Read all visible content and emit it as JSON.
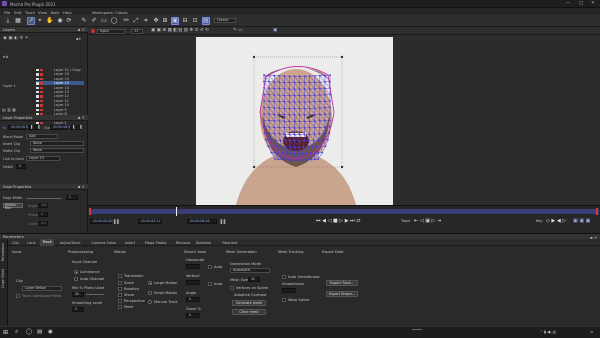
{
  "window": {
    "title": "Mocha Pro Plugin 2021"
  },
  "menu": [
    "File",
    "Edit",
    "Track",
    "View",
    "Tools",
    "Help",
    "Workspace: Classic"
  ],
  "toolbar": {
    "workspace": "Classic",
    "layer_select": "Input",
    "frame": "11"
  },
  "layers": {
    "title": "Layers",
    "items": [
      "Layer 21 / Copy",
      "Layer 20",
      "Layer 19",
      "Layer 15",
      "Layer 14",
      "Layer 13",
      "Layer 12",
      "Layer 11",
      "Layer 10",
      "Layer 9",
      "Layer 8",
      "Layer 7",
      "Layer 1"
    ],
    "selected_index": 3,
    "footer_label": "Layer 1"
  },
  "layer_props": {
    "title": "Layer Properties",
    "in_label": "In",
    "in_value": "00:00:00:00",
    "out_label": "Out",
    "out_value": "00:00:06:16",
    "blend_mode_label": "Blend Mode",
    "blend_mode": "Add",
    "insert_clip_label": "Insert Clip",
    "insert_clip": "None",
    "matte_clip_label": "Matte Clip",
    "matte_clip": "None",
    "link_track_label": "Link to track",
    "link_track": "Layer 23",
    "feather_label": "Detail",
    "feather": "0"
  },
  "edge_props": {
    "title": "Edge Properties",
    "edge_width_label": "Edge Width",
    "edge_width": "1",
    "motion_blur_label": "Motion Blur",
    "angle_label": "Angle",
    "angle": "180",
    "phase_label": "Phase",
    "phase": "0",
    "quality_label": "Quality",
    "quality": "0.0"
  },
  "timeline": {
    "start": "00:00:00:00",
    "end": "00:00:06:16",
    "current": "00:00:00:11",
    "track_label": "Track",
    "key_label": "Key"
  },
  "params": {
    "title": "Parameters",
    "tabs": [
      "Clip",
      "Lens",
      "Track",
      "AdjustTrack",
      "Camera Solve",
      "Insert",
      "Mega Plates",
      "Remove",
      "Stabilize",
      "Reorient"
    ],
    "selected_tab": "Track"
  },
  "side_tabs": [
    "Parameters",
    "Dope Sheet"
  ],
  "input": {
    "title": "Input",
    "clip_label": "Clip",
    "clip": "Layer Below",
    "track_individual": "Track Individual Fields"
  },
  "preprocessing": {
    "title": "Preprocessing",
    "input_channel": "Input Channel",
    "luminance": "Luminance",
    "auto_channel": "Auto Channel",
    "min_pixels": "Min % Pixels Used",
    "min_pixels_value": "90",
    "smoothing": "Smoothing Level",
    "smoothing_value": "0"
  },
  "motion": {
    "title": "Motion",
    "translation": "Translation",
    "scale": "Scale",
    "rotation": "Rotation",
    "shear": "Shear",
    "perspective": "Perspective",
    "mesh": "Mesh",
    "large_motion": "Large Motion",
    "small_motion": "Small Motion",
    "manual_track": "Manual Track"
  },
  "search_area": {
    "title": "Search Area",
    "horizontal": "Horizontal",
    "vertical": "Vertical",
    "angle": "Angle",
    "angle_value": "0",
    "zoom": "Zoom %",
    "zoom_value": "0",
    "auto": "Auto"
  },
  "mesh_generation": {
    "title": "Mesh Generation",
    "mode_label": "Generation Mode",
    "mode": "Automatic",
    "mesh_size": "Mesh Size",
    "mesh_size_value": "50",
    "vertices_on_spline": "Vertices on Spline",
    "adaptive_contrast": "Adaptive Contrast",
    "generate": "Generate mesh",
    "clear": "Clear mesh"
  },
  "mesh_tracking": {
    "title": "Mesh Tracking",
    "auto_smoothness": "Auto Smoothness",
    "smoothness": "Smoothness",
    "warp_spline": "Warp Spline"
  },
  "export": {
    "title": "Export Data",
    "export_tracking": "Export Track...",
    "export_shape": "Export Shape..."
  },
  "colors": {
    "accent": "#3a5a8f",
    "mesh": "#4a3fd6",
    "spline": "#c62aa6",
    "timeline_bar": "#3b3d78",
    "keyframe": "#d23a3a"
  }
}
